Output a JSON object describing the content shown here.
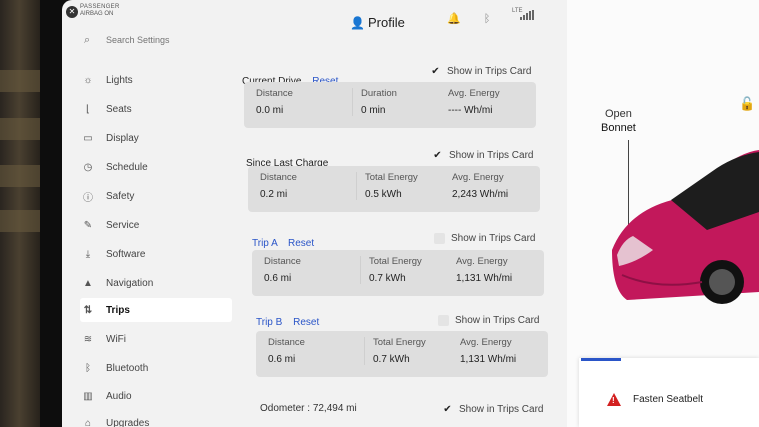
{
  "airbag": {
    "line1": "PASSENGER",
    "line2": "AIRBAG ON"
  },
  "header": {
    "profile_label": "Profile",
    "network": "LTE"
  },
  "search": {
    "placeholder": "Search Settings"
  },
  "sidebar": {
    "items": [
      {
        "label": "Lights",
        "icon": "sun-icon"
      },
      {
        "label": "Seats",
        "icon": "seat-icon"
      },
      {
        "label": "Display",
        "icon": "display-icon"
      },
      {
        "label": "Schedule",
        "icon": "clock-icon"
      },
      {
        "label": "Safety",
        "icon": "info-icon"
      },
      {
        "label": "Service",
        "icon": "wrench-icon"
      },
      {
        "label": "Software",
        "icon": "download-icon"
      },
      {
        "label": "Navigation",
        "icon": "navigation-arrow-icon"
      },
      {
        "label": "Trips",
        "icon": "trips-icon"
      },
      {
        "label": "WiFi",
        "icon": "wifi-icon"
      },
      {
        "label": "Bluetooth",
        "icon": "bluetooth-icon"
      },
      {
        "label": "Audio",
        "icon": "audio-icon"
      },
      {
        "label": "Upgrades",
        "icon": "upgrades-icon"
      }
    ],
    "active": "Trips"
  },
  "trips": {
    "show_label": "Show in Trips Card",
    "reset_label": "Reset",
    "current": {
      "title": "Current Drive",
      "show": true,
      "c1_label": "Distance",
      "c1_value": "0.0 mi",
      "c2_label": "Duration",
      "c2_value": "0 min",
      "c3_label": "Avg. Energy",
      "c3_value": "---- Wh/mi"
    },
    "since_charge": {
      "title": "Since Last Charge",
      "show": true,
      "c1_label": "Distance",
      "c1_value": "0.2 mi",
      "c2_label": "Total Energy",
      "c2_value": "0.5 kWh",
      "c3_label": "Avg. Energy",
      "c3_value": "2,243 Wh/mi"
    },
    "trip_a": {
      "title": "Trip A",
      "show": false,
      "c1_label": "Distance",
      "c1_value": "0.6 mi",
      "c2_label": "Total Energy",
      "c2_value": "0.7 kWh",
      "c3_label": "Avg. Energy",
      "c3_value": "1,131 Wh/mi"
    },
    "trip_b": {
      "title": "Trip B",
      "show": false,
      "c1_label": "Distance",
      "c1_value": "0.6 mi",
      "c2_label": "Total Energy",
      "c2_value": "0.7 kWh",
      "c3_label": "Avg. Energy",
      "c3_value": "1,131 Wh/mi"
    },
    "odometer_label": "Odometer :",
    "odometer_value": "72,494 mi",
    "odometer_show": true
  },
  "car": {
    "open_label": "Open",
    "bonnet_label": "Bonnet",
    "body_color": "#c2185b"
  },
  "alert": {
    "message": "Fasten Seatbelt"
  }
}
